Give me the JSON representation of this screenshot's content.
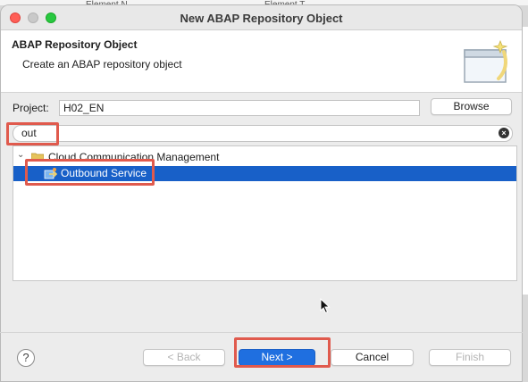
{
  "window": {
    "title": "New ABAP Repository Object"
  },
  "background": {
    "col1_label": "Element N",
    "col2_label": "Element T"
  },
  "header": {
    "title": "ABAP Repository Object",
    "subtitle": "Create an ABAP repository object",
    "icon": "wizard-banner-icon"
  },
  "project": {
    "label": "Project:",
    "value": "H02_EN",
    "browse_label": "Browse"
  },
  "filter": {
    "value": "out"
  },
  "tree": {
    "items": [
      {
        "label": "Cloud Communication Management",
        "icon": "folder-icon",
        "expanded": true
      },
      {
        "label": "Outbound Service",
        "icon": "outbound-service-icon",
        "selected": true
      }
    ]
  },
  "buttons": {
    "help": "?",
    "back": "< Back",
    "next": "Next >",
    "cancel": "Cancel",
    "finish": "Finish"
  },
  "colors": {
    "selection": "#1860c8",
    "highlight": "#e05a4d",
    "primary": "#1f6fe0"
  }
}
